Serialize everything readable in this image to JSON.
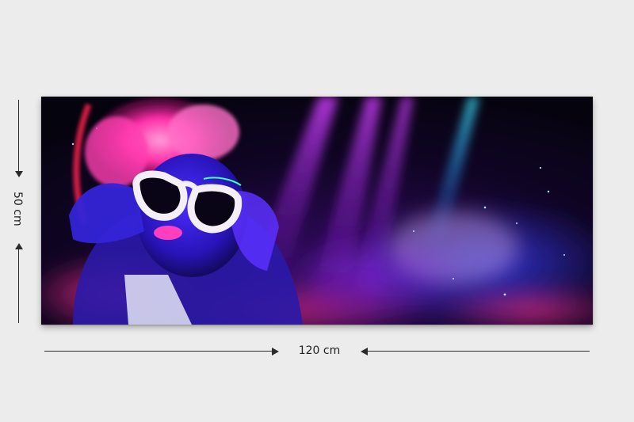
{
  "dimensions": {
    "height_label": "50 cm",
    "width_label": "120 cm"
  },
  "colors": {
    "background": "#ececec",
    "line": "#2b2b2b",
    "neon_pink": "#ff2fa0",
    "neon_purple": "#a020ff",
    "neon_blue": "#3a3aff",
    "neon_cyan": "#2fd8ff"
  }
}
